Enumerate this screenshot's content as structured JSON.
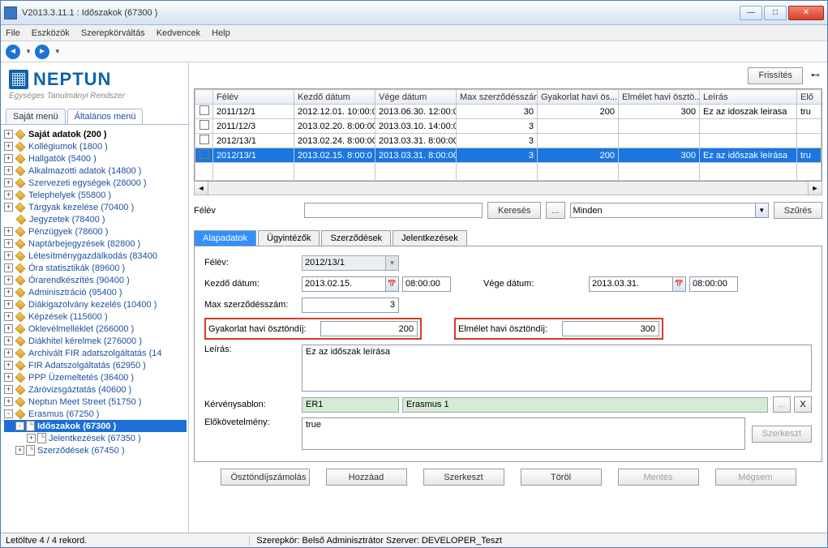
{
  "window": {
    "title": "V2013.3.11.1 : Időszakok (67300  )"
  },
  "menus": {
    "file": "File",
    "eszkozok": "Eszközök",
    "szerep": "Szerepkörváltás",
    "kedvencek": "Kedvencek",
    "help": "Help"
  },
  "logo": {
    "text": "NEPTUN",
    "sub": "Egységes Tanulmányi Rendszer"
  },
  "menuTabs": {
    "sajat": "Saját menü",
    "altalanos": "Általános menü"
  },
  "tree": [
    {
      "d": 0,
      "e": "+",
      "b": true,
      "t": "diamond",
      "l": "Saját adatok (200  )"
    },
    {
      "d": 0,
      "e": "+",
      "t": "diamond",
      "l": "Kollégiumok (1800  )"
    },
    {
      "d": 0,
      "e": "+",
      "t": "diamond",
      "l": "Hallgatók (5400  )"
    },
    {
      "d": 0,
      "e": "+",
      "t": "diamond",
      "l": "Alkalmazotti adatok (14800  )"
    },
    {
      "d": 0,
      "e": "+",
      "t": "diamond",
      "l": "Szervezeti egységek (28000  )"
    },
    {
      "d": 0,
      "e": "+",
      "t": "diamond",
      "l": "Telephelyek (55800  )"
    },
    {
      "d": 0,
      "e": "+",
      "t": "diamond",
      "l": "Tárgyak kezelése (70400  )"
    },
    {
      "d": 0,
      "e": "",
      "t": "diamond",
      "l": "Jegyzetek (78400  )"
    },
    {
      "d": 0,
      "e": "+",
      "t": "diamond",
      "l": "Pénzügyek (78600  )"
    },
    {
      "d": 0,
      "e": "+",
      "t": "diamond",
      "l": "Naptárbejegyzések (82800  )"
    },
    {
      "d": 0,
      "e": "+",
      "t": "diamond",
      "l": "Létesítménygazdálkodás (83400"
    },
    {
      "d": 0,
      "e": "+",
      "t": "diamond",
      "l": "Óra statisztikák (89600  )"
    },
    {
      "d": 0,
      "e": "+",
      "t": "diamond",
      "l": "Órarendkészítés (90400  )"
    },
    {
      "d": 0,
      "e": "+",
      "t": "diamond",
      "l": "Adminisztráció (95400  )"
    },
    {
      "d": 0,
      "e": "+",
      "t": "diamond",
      "l": "Diákigazolvány kezelés (10400  )"
    },
    {
      "d": 0,
      "e": "+",
      "t": "diamond",
      "l": "Képzések (115600  )"
    },
    {
      "d": 0,
      "e": "+",
      "t": "diamond",
      "l": "Oklevélmelléklet (266000  )"
    },
    {
      "d": 0,
      "e": "+",
      "t": "diamond",
      "l": "Diákhitel kérelmek (276000  )"
    },
    {
      "d": 0,
      "e": "+",
      "t": "diamond",
      "l": "Archivált FIR adatszolgáltatás (14"
    },
    {
      "d": 0,
      "e": "+",
      "t": "diamond",
      "l": "FIR Adatszolgáltatás (62950  )"
    },
    {
      "d": 0,
      "e": "+",
      "t": "diamond",
      "l": "PPP Üzemeltetés (36400  )"
    },
    {
      "d": 0,
      "e": "+",
      "t": "diamond",
      "l": "Záróvizsgáztatás (40600  )"
    },
    {
      "d": 0,
      "e": "+",
      "t": "diamond",
      "l": "Neptun Meet Street (51750  )"
    },
    {
      "d": 0,
      "e": "-",
      "t": "diamond",
      "l": "Erasmus (67250  )"
    },
    {
      "d": 1,
      "e": "-",
      "t": "page",
      "l": "Időszakok  (67300  )",
      "sel": true
    },
    {
      "d": 2,
      "e": "+",
      "t": "page",
      "l": "Jelentkezések (67350  )"
    },
    {
      "d": 1,
      "e": "+",
      "t": "page",
      "l": "Szerződések (67450  )"
    }
  ],
  "topBtn": {
    "frissites": "Frissítés"
  },
  "grid": {
    "cols": [
      "Félév",
      "Kezdő dátum",
      "Vége dátum",
      "Max szerződésszám",
      "Gyakorlat havi ös...",
      "Elmélet havi ösztö...",
      "Leírás",
      "Elő"
    ],
    "rows": [
      {
        "felev": "2011/12/1",
        "kezdo": "2012.12.01. 10:00:0",
        "vege": "2013.06.30. 12:00:0",
        "max": "30",
        "gyak": "200",
        "elm": "300",
        "leiras": "Ez az idoszak leirasa",
        "elo": "tru"
      },
      {
        "felev": "2011/12/3",
        "kezdo": "2013.02.20. 8:00:00",
        "vege": "2013.03.10. 14:00:0",
        "max": "3",
        "gyak": "",
        "elm": "",
        "leiras": "",
        "elo": ""
      },
      {
        "felev": "2012/13/1",
        "kezdo": "2013.02.24. 8:00:00",
        "vege": "2013.03.31. 8:00:00",
        "max": "3",
        "gyak": "",
        "elm": "",
        "leiras": "",
        "elo": ""
      },
      {
        "felev": "2012/13/1",
        "kezdo": "2013.02.15. 8:00:0",
        "vege": "2013.03.31. 8:00:00",
        "max": "3",
        "gyak": "200",
        "elm": "300",
        "leiras": "Ez az időszak leírása",
        "elo": "tru",
        "sel": true
      }
    ]
  },
  "search": {
    "label": "Félév",
    "keresBtn": "Keresés",
    "dots": "...",
    "combo": "Minden",
    "szures": "Szűrés"
  },
  "tabs": {
    "alap": "Alapadatok",
    "ugy": "Ügyintézők",
    "szerz": "Szerződések",
    "jel": "Jelentkezések"
  },
  "form": {
    "felevLabel": "Félév:",
    "felevVal": "2012/13/1",
    "kezdoLabel": "Kezdő dátum:",
    "kezdoDate": "2013.02.15.",
    "kezdoTime": "08:00:00",
    "vegeLabel": "Vége dátum:",
    "vegeDate": "2013.03.31.",
    "vegeTime": "08:00:00",
    "maxLabel": "Max szerződésszám:",
    "maxVal": "3",
    "gyakLabel": "Gyakorlat havi ösztöndíj:",
    "gyakVal": "200",
    "elmLabel": "Elmélet havi ösztöndíj:",
    "elmVal": "300",
    "leirasLabel": "Leírás:",
    "leirasVal": "Ez az időszak leírása",
    "kervLabel": "Kérvénysablon:",
    "kervCode": "ER1",
    "kervName": "Erasmus 1",
    "elokLabel": "Előkövetelmény:",
    "elokVal": "true",
    "szerkBtn": "Szerkeszt",
    "xBtn": "X",
    "dotsBtn": "..."
  },
  "buttons": {
    "oszt": "Ösztöndíjszámolás",
    "hozzaad": "Hozzáad",
    "szerk": "Szerkeszt",
    "torol": "Töröl",
    "mentes": "Mentés",
    "megsem": "Mégsem"
  },
  "status": {
    "left": "Letöltve 4 / 4 rekord.",
    "mid": "Szerepkör: Belső Adminisztrátor   Szerver: DEVELOPER_Teszt"
  }
}
